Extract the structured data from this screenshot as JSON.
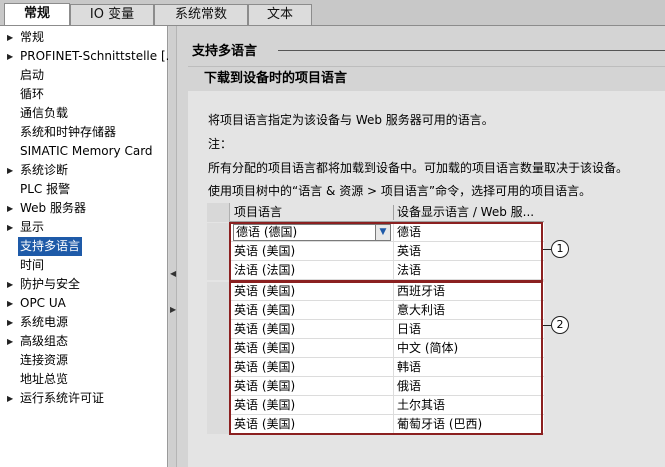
{
  "tabs": [
    {
      "label": "常规",
      "active": true
    },
    {
      "label": "IO 变量",
      "active": false
    },
    {
      "label": "系统常数",
      "active": false
    },
    {
      "label": "文本",
      "active": false
    }
  ],
  "sidebar": {
    "items": [
      {
        "label": "常规",
        "expandable": true
      },
      {
        "label": "PROFINET-Schnittstelle [...",
        "expandable": true
      },
      {
        "label": "启动",
        "expandable": false
      },
      {
        "label": "循环",
        "expandable": false
      },
      {
        "label": "通信负载",
        "expandable": false
      },
      {
        "label": "系统和时钟存储器",
        "expandable": false
      },
      {
        "label": "SIMATIC Memory Card",
        "expandable": false
      },
      {
        "label": "系统诊断",
        "expandable": true
      },
      {
        "label": "PLC 报警",
        "expandable": false
      },
      {
        "label": "Web 服务器",
        "expandable": true
      },
      {
        "label": "显示",
        "expandable": true
      },
      {
        "label": "支持多语言",
        "expandable": false,
        "selected": true
      },
      {
        "label": "时间",
        "expandable": false
      },
      {
        "label": "防护与安全",
        "expandable": true
      },
      {
        "label": "OPC UA",
        "expandable": true
      },
      {
        "label": "系统电源",
        "expandable": true
      },
      {
        "label": "高级组态",
        "expandable": true
      },
      {
        "label": "连接资源",
        "expandable": false
      },
      {
        "label": "地址总览",
        "expandable": false
      },
      {
        "label": "运行系统许可证",
        "expandable": true
      }
    ]
  },
  "main": {
    "section_title": "支持多语言",
    "panel_title": "下载到设备时的项目语言",
    "descriptions": [
      "将项目语言指定为该设备与 Web 服务器可用的语言。",
      "注：",
      "所有分配的项目语言都将加载到设备中。可加载的项目语言数量取决于该设备。",
      "使用项目树中的“语言 & 资源 > 项目语言”命令，选择可用的项目语言。"
    ],
    "table": {
      "headers": [
        "项目语言",
        "设备显示语言 / Web 服..."
      ],
      "rows": [
        {
          "project_language": "德语 (德国)",
          "display_language": "德语",
          "dropdown": true
        },
        {
          "project_language": "英语 (美国)",
          "display_language": "英语"
        },
        {
          "project_language": "法语 (法国)",
          "display_language": "法语"
        },
        {
          "project_language": "英语 (美国)",
          "display_language": "西班牙语"
        },
        {
          "project_language": "英语 (美国)",
          "display_language": "意大利语"
        },
        {
          "project_language": "英语 (美国)",
          "display_language": "日语"
        },
        {
          "project_language": "英语 (美国)",
          "display_language": "中文 (简体)"
        },
        {
          "project_language": "英语 (美国)",
          "display_language": "韩语"
        },
        {
          "project_language": "英语 (美国)",
          "display_language": "俄语"
        },
        {
          "project_language": "英语 (美国)",
          "display_language": "土尔其语"
        },
        {
          "project_language": "英语 (美国)",
          "display_language": "葡萄牙语 (巴西)"
        }
      ]
    },
    "callouts": [
      "1",
      "2"
    ]
  },
  "colors": {
    "selected_bg": "#1e5aa8",
    "group_border": "#8b2020"
  }
}
